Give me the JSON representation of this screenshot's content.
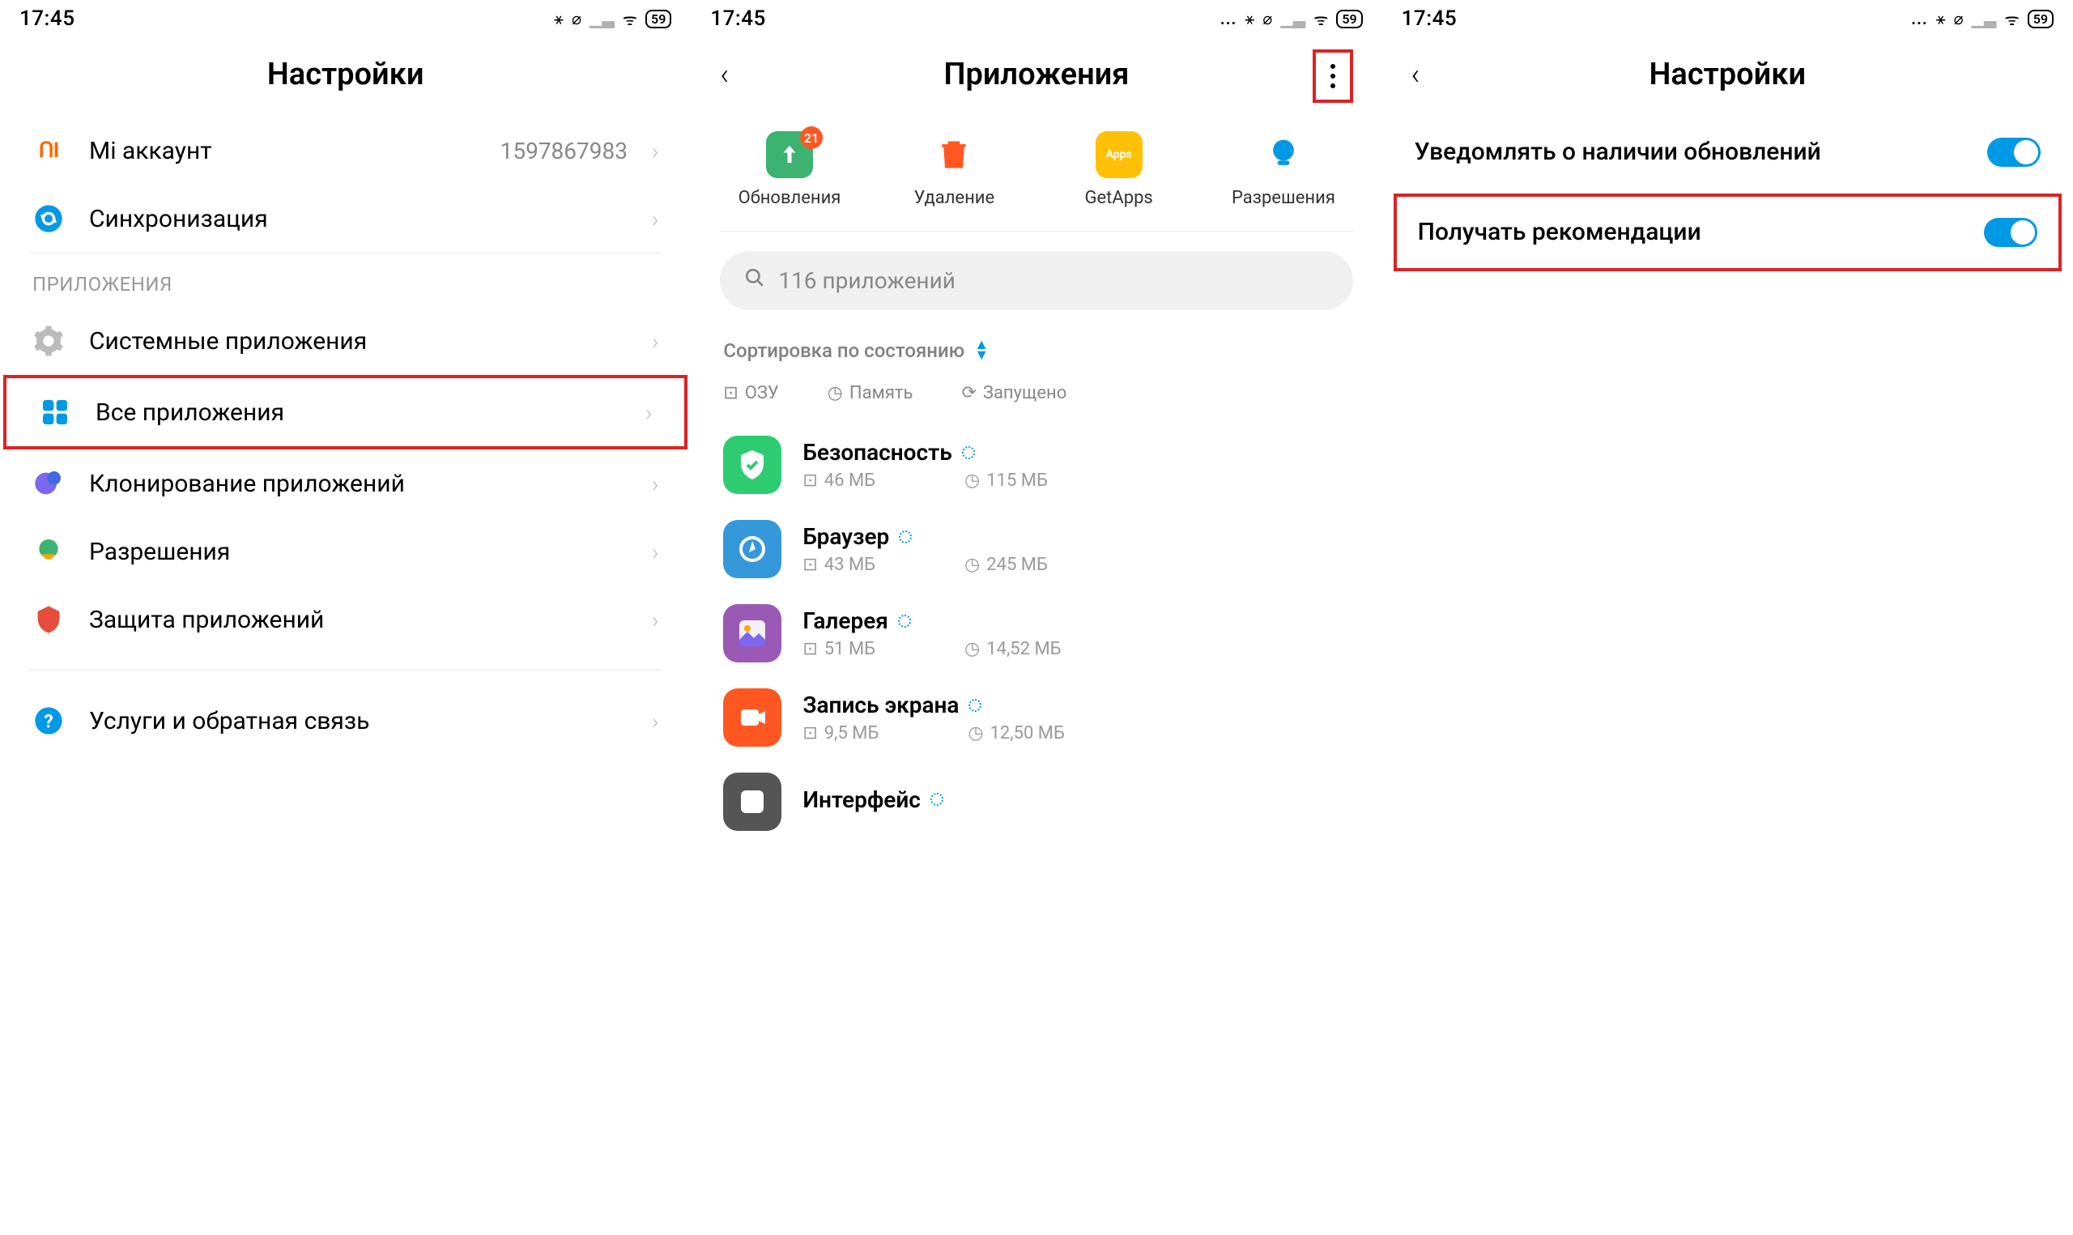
{
  "status": {
    "time": "17:45",
    "battery": "59"
  },
  "panel1": {
    "title": "Настройки",
    "mi_account": {
      "label": "Mi аккаунт",
      "value": "1597867983"
    },
    "sync": {
      "label": "Синхронизация"
    },
    "section_apps": "ПРИЛОЖЕНИЯ",
    "system_apps": "Системные приложения",
    "all_apps": "Все приложения",
    "app_clone": "Клонирование приложений",
    "permissions": "Разрешения",
    "app_protection": "Защита приложений",
    "feedback": "Услуги и обратная связь"
  },
  "panel2": {
    "title": "Приложения",
    "actions": {
      "updates": "Обновления",
      "updates_badge": "21",
      "delete": "Удаление",
      "getapps": "GetApps",
      "permissions": "Разрешения"
    },
    "search_placeholder": "116 приложений",
    "sort_label": "Сортировка по состоянию",
    "filters": {
      "ram": "ОЗУ",
      "memory": "Память",
      "running": "Запущено"
    },
    "apps": [
      {
        "name": "Безопасность",
        "ram": "46 МБ",
        "storage": "115 МБ",
        "color": "#2ecc71",
        "glyph": "shield"
      },
      {
        "name": "Браузер",
        "ram": "43 МБ",
        "storage": "245 МБ",
        "color": "#3498db",
        "glyph": "compass"
      },
      {
        "name": "Галерея",
        "ram": "51 МБ",
        "storage": "14,52 МБ",
        "color": "#9b59b6",
        "glyph": "gallery"
      },
      {
        "name": "Запись экрана",
        "ram": "9,5 МБ",
        "storage": "12,50 МБ",
        "color": "#ff5722",
        "glyph": "record"
      },
      {
        "name": "Интерфейс",
        "ram": "",
        "storage": "",
        "color": "#555",
        "glyph": "ui"
      }
    ]
  },
  "panel3": {
    "title": "Настройки",
    "notify_updates": "Уведомлять о наличии обновлений",
    "recommendations": "Получать рекомендации"
  }
}
